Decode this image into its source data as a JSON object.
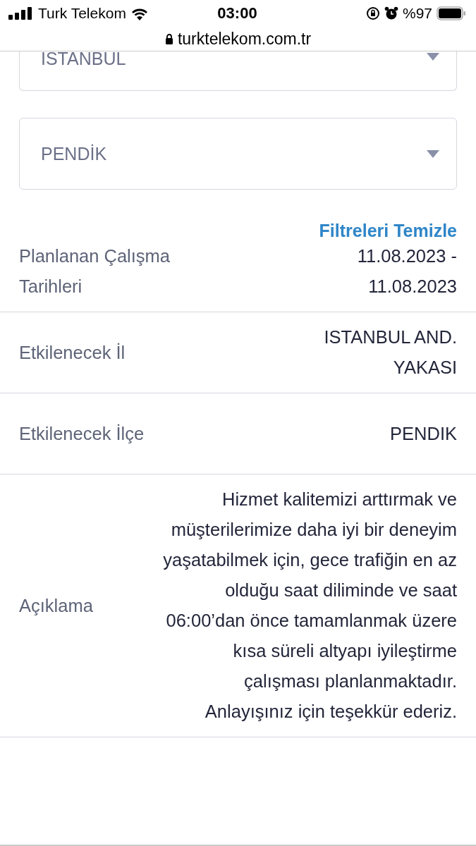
{
  "status_bar": {
    "carrier": "Turk Telekom",
    "time": "03:00",
    "battery": "%97"
  },
  "address_bar": {
    "url": "turktelekom.com.tr"
  },
  "filters": [
    {
      "value": "ISTANBUL"
    },
    {
      "value": "PENDİK"
    }
  ],
  "clear_filters": "Filtreleri Temizle",
  "details": [
    {
      "label": "Planlanan Çalışma Tarihleri",
      "value": "11.08.2023 - 11.08.2023"
    },
    {
      "label": "Etkilenecek İl",
      "value": "ISTANBUL AND. YAKASI"
    },
    {
      "label": "Etkilenecek İlçe",
      "value": "PENDIK"
    },
    {
      "label": "Açıklama",
      "value": "Hizmet kalitemizi arttırmak ve müşterilerimize daha iyi bir deneyim yaşatabilmek için, gece trafiğin en az olduğu saat diliminde ve saat 06:00’dan önce tamamlanmak üzere kısa süreli altyapı iyileştirme çalışması planlanmaktadır. Anlayışınız için teşekkür ederiz."
    }
  ]
}
